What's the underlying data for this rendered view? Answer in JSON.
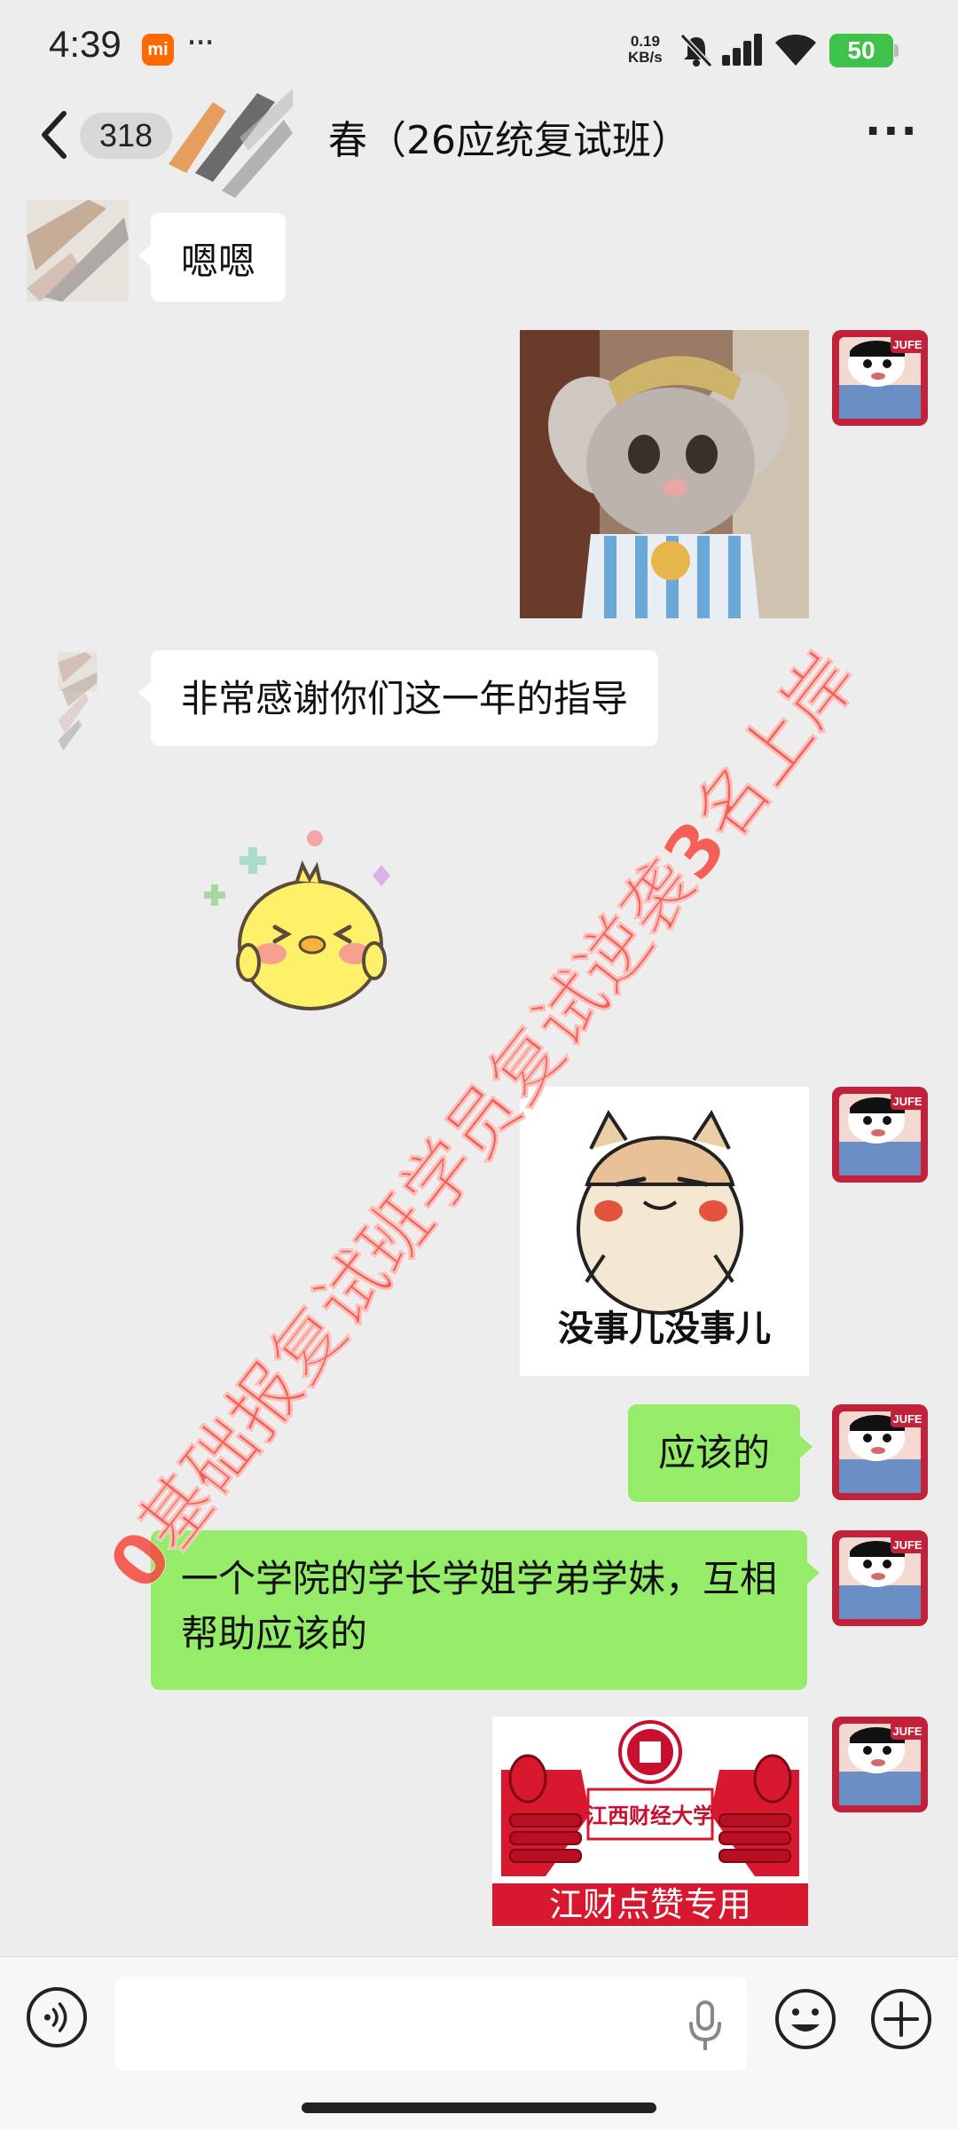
{
  "status_bar": {
    "time": "4:39",
    "app_badge": "mi",
    "dots": "···",
    "net_speed_value": "0.19",
    "net_speed_unit": "KB/s",
    "battery": "50"
  },
  "header": {
    "unread_count": "318",
    "title": "春（26应统复试班）",
    "more": "···"
  },
  "messages": [
    {
      "side": "left",
      "type": "text",
      "text": "嗯嗯"
    },
    {
      "side": "right",
      "type": "sticker",
      "icon": "plush-cat-sticker"
    },
    {
      "side": "left",
      "type": "text",
      "text": "非常感谢你们这一年的指导"
    },
    {
      "side": "left",
      "type": "sticker",
      "icon": "yellow-chick-sticker"
    },
    {
      "side": "right",
      "type": "sticker",
      "icon": "hamster-sticker",
      "caption": "没事儿没事儿"
    },
    {
      "side": "right",
      "type": "text",
      "text": "应该的"
    },
    {
      "side": "right",
      "type": "text",
      "text": "一个学院的学长学姐学弟学妹，互相帮助应该的"
    },
    {
      "side": "right",
      "type": "sticker",
      "icon": "jufe-thumbs-up-sticker",
      "emblem_text": "江西财经大学",
      "caption": "江财点赞专用"
    }
  ],
  "my_avatar": {
    "badge": "JUFE"
  },
  "watermark": "0基础报复试班学员复试逆袭3名上岸",
  "colors": {
    "bubble_green": "#95ec69",
    "bubble_white": "#ffffff",
    "background": "#ededed",
    "watermark": "#f5463c"
  }
}
